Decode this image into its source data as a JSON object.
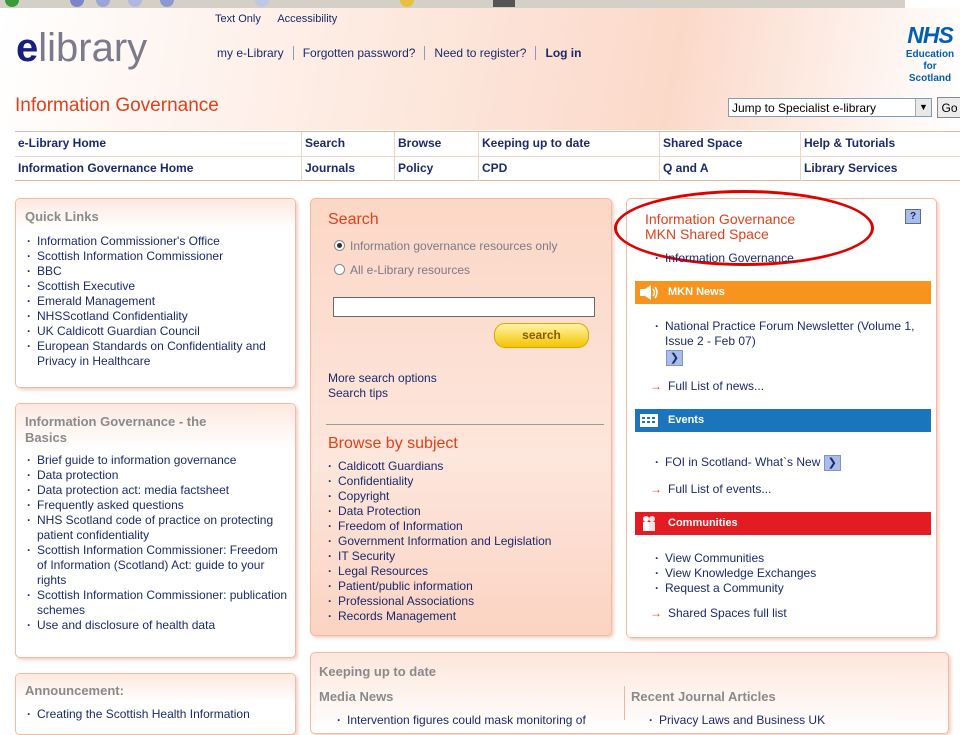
{
  "header": {
    "logo_e": "e",
    "logo_rest": "library",
    "top_links": [
      "Text Only",
      "Accessibility"
    ],
    "user_links": [
      "my e-Library",
      "Forgotten password?",
      "Need to register?",
      "Log in"
    ],
    "nhs": {
      "mark": "NHS",
      "line1": "Education",
      "line2": "for",
      "line3": "Scotland"
    },
    "section_title": "Information Governance",
    "jump_select": "Jump to Specialist e-library",
    "go_label": "Go"
  },
  "nav": {
    "row1": [
      "e-Library Home",
      "Search",
      "Browse",
      "Keeping up to date",
      "Shared Space",
      "Help & Tutorials"
    ],
    "row2": [
      "Information Governance Home",
      "Journals",
      "Policy",
      "CPD",
      "Q and A",
      "Library Services"
    ]
  },
  "quick_links": {
    "title": "Quick Links",
    "items": [
      "Information Commissioner's Office",
      "Scottish Information Commissioner",
      "BBC",
      "Scottish Executive",
      "Emerald Management",
      "NHSScotland Confidentiality",
      "UK Caldicott Guardian Council",
      "European Standards on Confidentiality and Privacy in Healthcare"
    ]
  },
  "basics": {
    "title_line1": "Information Governance - the",
    "title_line2": "Basics",
    "items": [
      "Brief guide to information governance",
      "Data protection",
      "Data protection act: media factsheet",
      "Frequently asked questions",
      "NHS Scotland code of practice on protecting patient confidentiality",
      "Scottish Information Commissioner: Freedom of Information (Scotland) Act: guide to your rights",
      "Scottish Information Commissioner: publication schemes",
      "Use and disclosure of health data"
    ]
  },
  "announcement": {
    "title": "Announcement:",
    "items": [
      "Creating the Scottish Health Information"
    ]
  },
  "search": {
    "title": "Search",
    "option1": "Information governance resources only",
    "option2": "All e-Library resources",
    "query": "",
    "button": "search",
    "more_options": "More search options",
    "tips": "Search tips"
  },
  "browse": {
    "title": "Browse by subject",
    "items": [
      "Caldicott Guardians",
      "Confidentiality",
      "Copyright",
      "Data Protection",
      "Freedom of Information",
      "Government Information and Legislation",
      "IT Security",
      "Legal Resources",
      "Patient/public information",
      "Professional Associations",
      "Records Management"
    ]
  },
  "shared_space": {
    "title_line1": "Information Governance",
    "title_line2": "MKN Shared Space",
    "help": "?",
    "link": "Information Governance",
    "news_header": "MKN News",
    "news_item": "National Practice Forum Newsletter (Volume 1, Issue 2 - Feb 07)",
    "news_full": "Full List of news...",
    "events_header": "Events",
    "event_item": "FOI in Scotland- What`s New",
    "events_full": "Full List of events...",
    "communities_header": "Communities",
    "communities_items": [
      "View Communities",
      "View Knowledge Exchanges",
      "Request a Community"
    ],
    "shared_full": "Shared Spaces full list",
    "colors": {
      "news": "#f7941d",
      "events": "#1b75bc",
      "communities": "#e31b23",
      "highlight": "#e00000"
    }
  },
  "keeping": {
    "title": "Keeping up to date",
    "media_title": "Media News",
    "media_item": "Intervention figures could mask monitoring of",
    "journals_title": "Recent Journal Articles",
    "journal_item": "Privacy Laws and Business UK"
  }
}
